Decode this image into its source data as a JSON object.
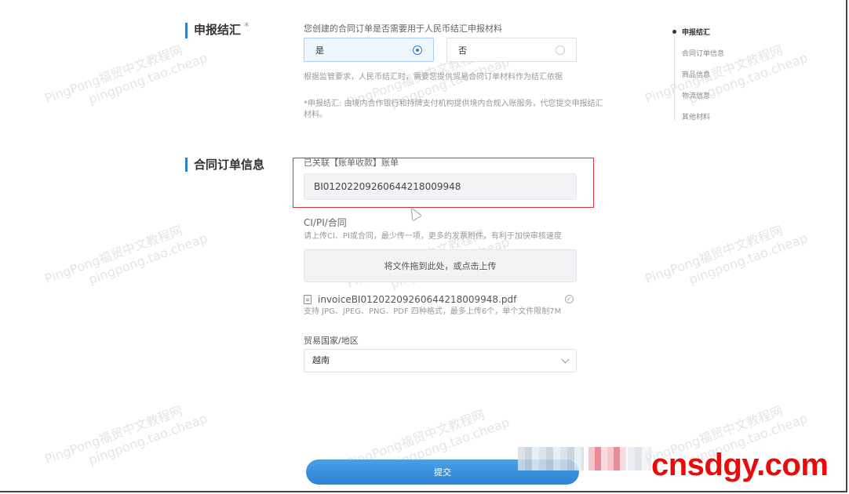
{
  "colors": {
    "accent": "#2b7fd3",
    "highlight": "#d9363e",
    "brand": "#ea0a0a"
  },
  "section1": {
    "title": "申报结汇",
    "required_mark": "*",
    "question": "您创建的合同订单是否需要用于人民币结汇申报材料",
    "options": [
      {
        "label": "是",
        "selected": true
      },
      {
        "label": "否",
        "selected": false
      }
    ],
    "hint": "根据监管要求，人民币结汇时，需要您提供贸易合同订单材料作为结汇依据",
    "note_line1": "*申报结汇: 由境内合作银行和持牌支付机构提供境内合规入账服务，代您提交申报结汇",
    "note_line2": "材料。"
  },
  "section2": {
    "title": "合同订单信息",
    "linked_label": "已关联【账单收款】账单",
    "linked_value": "BI01202209260644218009948",
    "ci_label": "CI/PI/合同",
    "ci_hint": "请上传CI、PI或合同，最少传一项，更多的发票附件，有利于加快审核速度",
    "upload_text": "将文件拖到此处，或点击上传",
    "file_name": "invoiceBI01202209260644218009948.pdf",
    "file_check": "✓",
    "file_hint": "支持 JPG、JPEG、PNG、PDF 四种格式，最多上传6个，单个文件限制7M",
    "country_label": "贸易国家/地区",
    "country_value": "越南"
  },
  "nav": {
    "items": [
      "申报结汇",
      "合同订单信息",
      "商品信息",
      "物流信息",
      "其他材料"
    ],
    "active_index": 0
  },
  "submit_label": "提交",
  "watermark": {
    "line1": "PingPong福贸中文教程网",
    "line2": "pingpong.tao.cheap"
  },
  "brand_text": "cnsdgy.com"
}
